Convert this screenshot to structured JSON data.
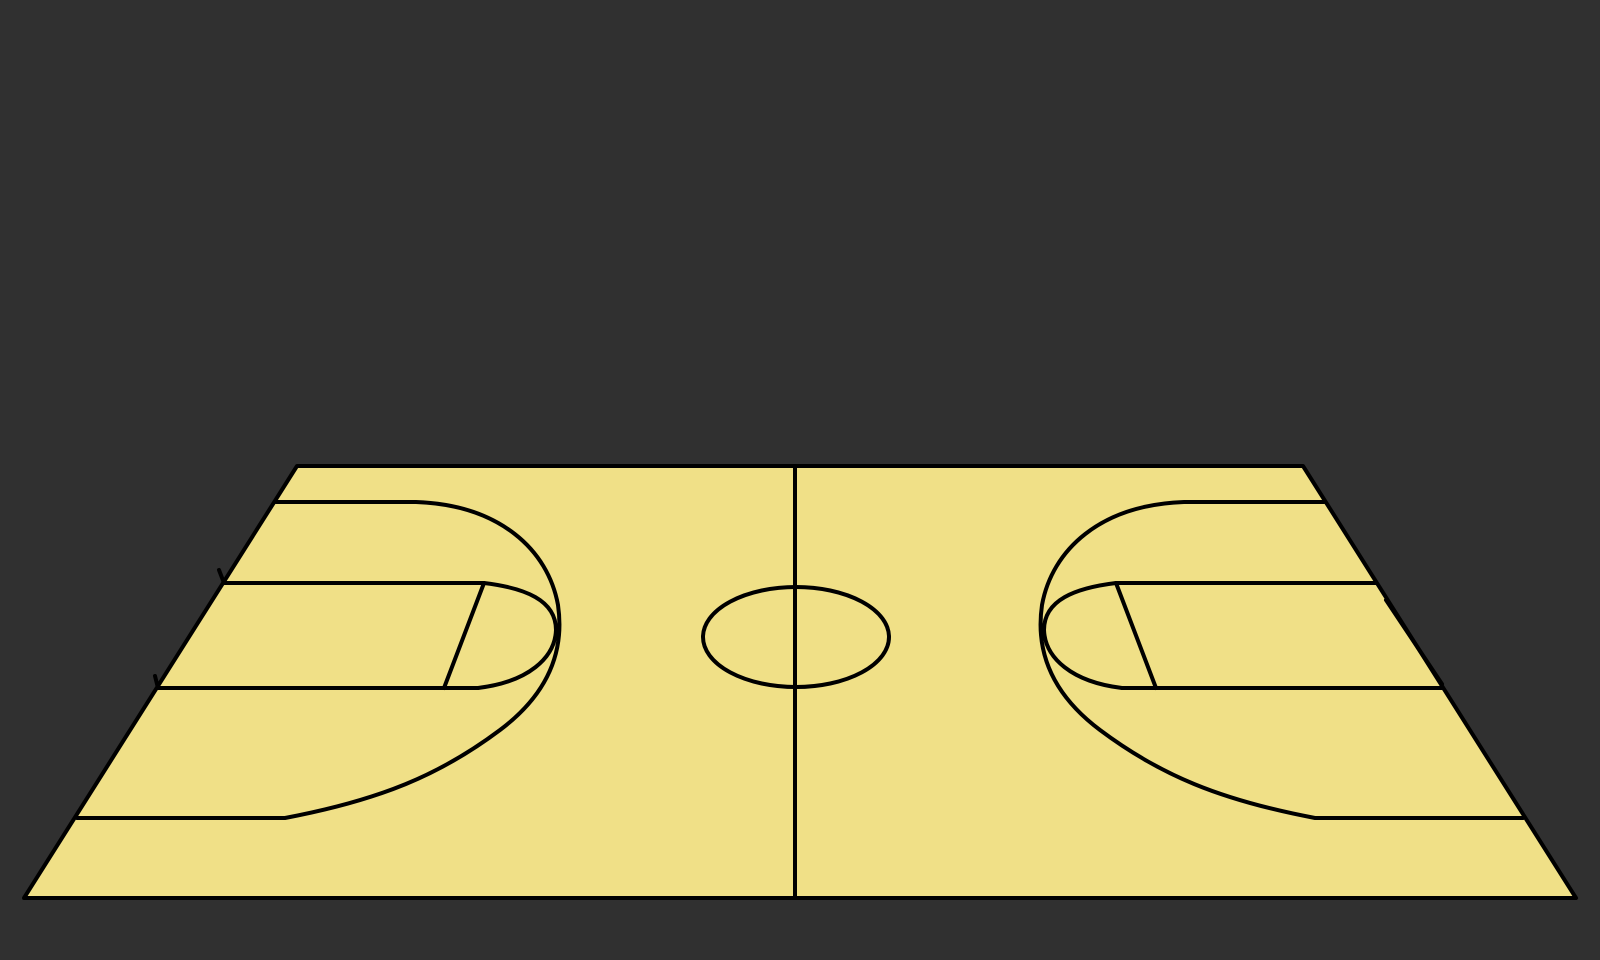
{
  "scene": {
    "background_color": "#303030",
    "floor_color": "#F0E087",
    "line_color": "#000000",
    "view": "perspective-full-court"
  }
}
